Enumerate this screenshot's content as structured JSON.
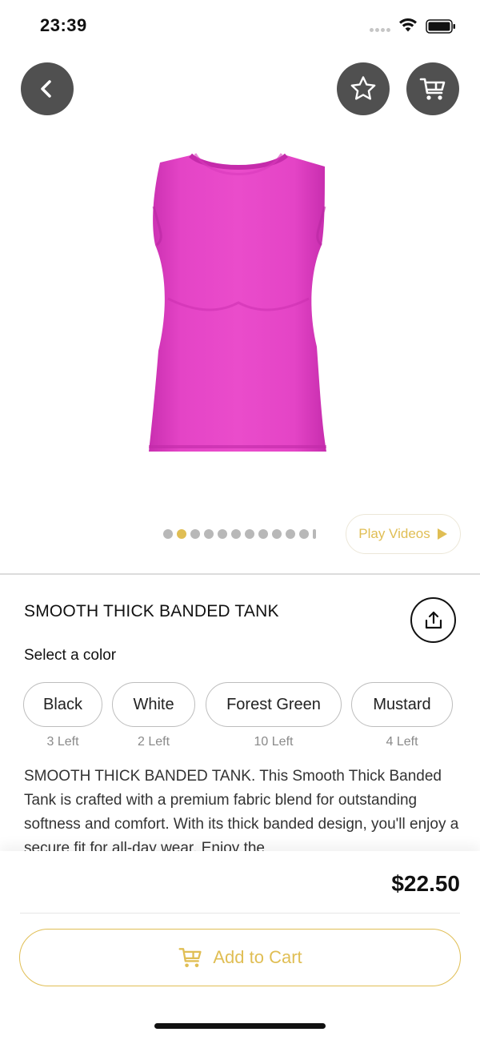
{
  "status_bar": {
    "time": "23:39"
  },
  "header": {
    "back_icon": "chevron-left-icon",
    "favorite_icon": "star-icon",
    "cart_icon": "cart-icon"
  },
  "product": {
    "image_icon": "pink-tank-top-image",
    "image_color": "#e040c0",
    "title": "SMOOTH THICK BANDED TANK",
    "description": "SMOOTH THICK BANDED TANK. This Smooth Thick Banded Tank is crafted with a premium fabric blend for outstanding softness and comfort. With its thick banded design, you'll enjoy a secure fit for all-day wear. Enjoy the"
  },
  "gallery": {
    "play_videos_label": "Play Videos"
  },
  "color_select": {
    "label": "Select a color",
    "options": [
      {
        "name": "Black",
        "stock": "3 Left"
      },
      {
        "name": "White",
        "stock": "2 Left"
      },
      {
        "name": "Forest Green",
        "stock": "10 Left"
      },
      {
        "name": "Mustard",
        "stock": "4 Left"
      }
    ]
  },
  "footer": {
    "price": "$22.50",
    "add_to_cart_label": "Add to Cart"
  },
  "colors": {
    "accent": "#e0be54",
    "button_bg": "#505050"
  }
}
